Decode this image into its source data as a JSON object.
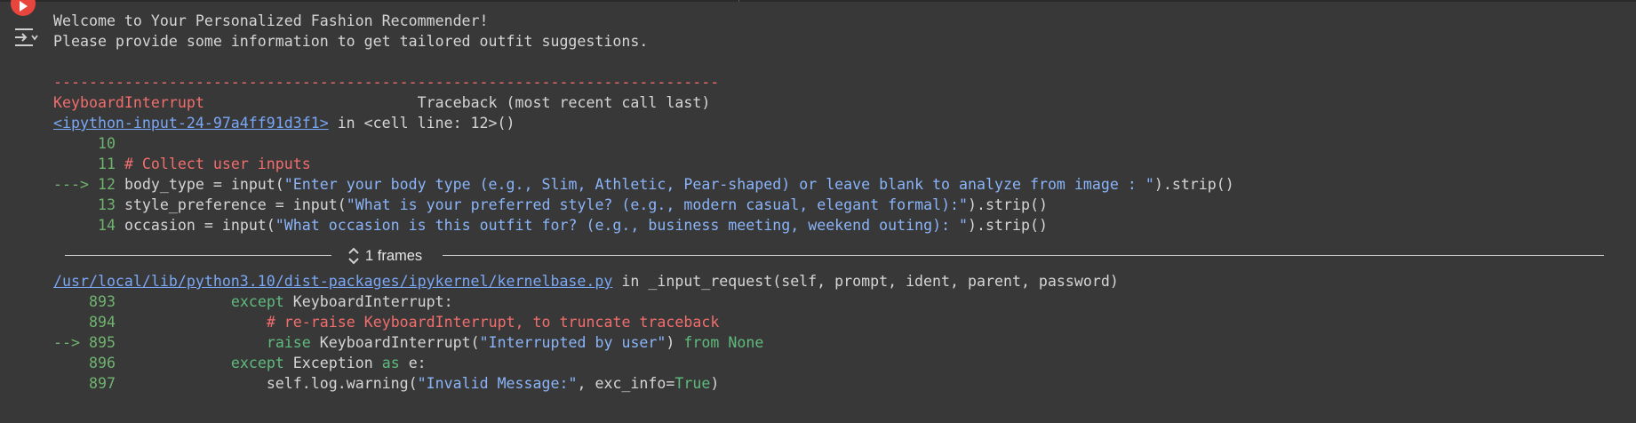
{
  "cell": {
    "output_lines": {
      "welcome": "Welcome to Your Personalized Fashion Recommender!",
      "please": "Please provide some information to get tailored outfit suggestions."
    },
    "traceback": {
      "dashes": "---------------------------------------------------------------------------",
      "error_name": "KeyboardInterrupt",
      "header_right": "Traceback (most recent call last)",
      "frame1": {
        "file_link": "<ipython-input-24-97a4ff91d3f1>",
        "location": " in <cell line: 12>()",
        "lines": [
          {
            "marker": "    ",
            "number": "10",
            "code": [
              {
                "t": "",
                "c": ""
              }
            ]
          },
          {
            "marker": "    ",
            "number": "11",
            "code": [
              {
                "t": "# Collect user inputs",
                "c": "comment"
              }
            ]
          },
          {
            "marker": "--->",
            "number": "12",
            "code": [
              {
                "t": "body_type = input(",
                "c": ""
              },
              {
                "t": "\"Enter your body type (e.g., Slim, Athletic, Pear-shaped) or leave blank to analyze from image : \"",
                "c": "str"
              },
              {
                "t": ").strip()",
                "c": ""
              }
            ]
          },
          {
            "marker": "    ",
            "number": "13",
            "code": [
              {
                "t": "style_preference = input(",
                "c": ""
              },
              {
                "t": "\"What is your preferred style? (e.g., modern casual, elegant formal):\"",
                "c": "str"
              },
              {
                "t": ").strip()",
                "c": ""
              }
            ]
          },
          {
            "marker": "    ",
            "number": "14",
            "code": [
              {
                "t": "occasion = input(",
                "c": ""
              },
              {
                "t": "\"What occasion is this outfit for? (e.g., business meeting, weekend outing): \"",
                "c": "str"
              },
              {
                "t": ").strip()",
                "c": ""
              }
            ]
          }
        ]
      },
      "frames_label": "1 frames",
      "frame2": {
        "file_link": "/usr/local/lib/python3.10/dist-packages/ipykernel/kernelbase.py",
        "location": " in _input_request(self, prompt, ident, parent, password)",
        "lines": [
          {
            "marker": "   ",
            "number": "893",
            "code": [
              {
                "t": "            ",
                "c": ""
              },
              {
                "t": "except",
                "c": "kw"
              },
              {
                "t": " KeyboardInterrupt:",
                "c": ""
              }
            ]
          },
          {
            "marker": "   ",
            "number": "894",
            "code": [
              {
                "t": "                ",
                "c": ""
              },
              {
                "t": "# re-raise KeyboardInterrupt, to truncate traceback",
                "c": "comment"
              }
            ]
          },
          {
            "marker": "-->",
            "number": "895",
            "code": [
              {
                "t": "                ",
                "c": ""
              },
              {
                "t": "raise",
                "c": "kw"
              },
              {
                "t": " KeyboardInterrupt(",
                "c": ""
              },
              {
                "t": "\"Interrupted by user\"",
                "c": "str"
              },
              {
                "t": ") ",
                "c": ""
              },
              {
                "t": "from",
                "c": "kw"
              },
              {
                "t": " ",
                "c": ""
              },
              {
                "t": "None",
                "c": "const"
              }
            ]
          },
          {
            "marker": "   ",
            "number": "896",
            "code": [
              {
                "t": "            ",
                "c": ""
              },
              {
                "t": "except",
                "c": "kw"
              },
              {
                "t": " Exception ",
                "c": ""
              },
              {
                "t": "as",
                "c": "kw"
              },
              {
                "t": " e:",
                "c": ""
              }
            ]
          },
          {
            "marker": "   ",
            "number": "897",
            "code": [
              {
                "t": "                self.log.warning(",
                "c": ""
              },
              {
                "t": "\"Invalid Message:\"",
                "c": "str"
              },
              {
                "t": ", exc_info=",
                "c": ""
              },
              {
                "t": "True",
                "c": "const"
              },
              {
                "t": ")",
                "c": ""
              }
            ]
          }
        ]
      }
    }
  },
  "icons": {
    "run": "play-icon",
    "output_options": "output-options-icon",
    "expand_frames": "expand-collapse-icon"
  },
  "colors": {
    "background": "#383838",
    "run_button": "#e8453c",
    "error_red": "#f26d6d",
    "link_blue": "#7aa7f5",
    "line_number_green": "#6fb36f",
    "string_blue": "#8ab4f8",
    "keyword_green": "#5fba7d"
  }
}
